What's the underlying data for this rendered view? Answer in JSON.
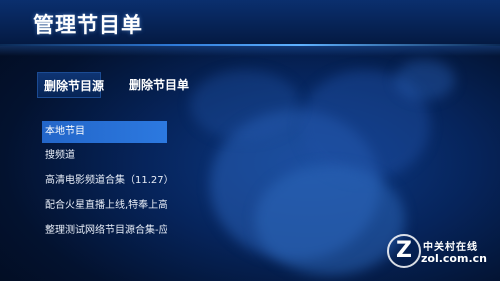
{
  "header": {
    "title": "管理节目单"
  },
  "tabs": [
    {
      "label": "删除节目源",
      "active": true
    },
    {
      "label": "删除节目单",
      "active": false
    }
  ],
  "list": {
    "items": [
      {
        "label": "本地节目",
        "selected": true
      },
      {
        "label": "搜频道",
        "selected": false
      },
      {
        "label": "高清电影频道合集（11.27）",
        "selected": false
      },
      {
        "label": "配合火星直播上线,特奉上高",
        "selected": false
      },
      {
        "label": "整理测试网络节目源合集-应",
        "selected": false
      }
    ]
  },
  "watermark": {
    "mark": "Z",
    "cn": "中关村在线",
    "en": "zol.com.cn"
  },
  "colors": {
    "background": "#03122f",
    "selected": "#2c79e0",
    "tab_active": "#0e3473"
  }
}
